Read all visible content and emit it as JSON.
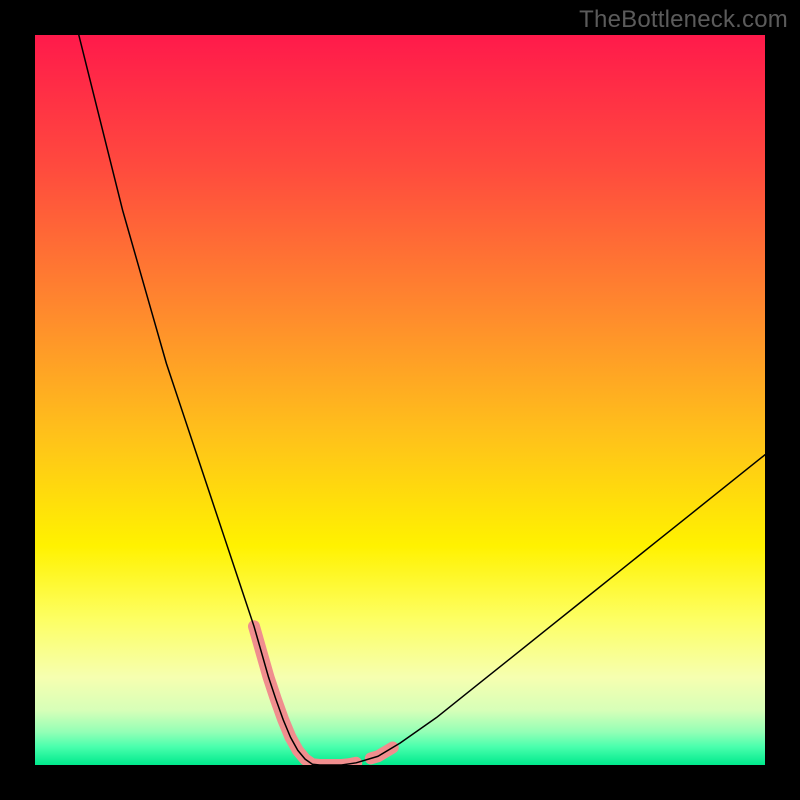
{
  "watermark": "TheBottleneck.com",
  "chart_data": {
    "type": "line",
    "title": "",
    "xlabel": "",
    "ylabel": "",
    "xlim": [
      0,
      100
    ],
    "ylim": [
      0,
      100
    ],
    "grid": false,
    "legend": false,
    "background": {
      "type": "vertical-gradient",
      "stops": [
        {
          "pos": 0.0,
          "color": "#ff1a4b"
        },
        {
          "pos": 0.18,
          "color": "#ff4a3e"
        },
        {
          "pos": 0.38,
          "color": "#ff8a2d"
        },
        {
          "pos": 0.55,
          "color": "#ffc21a"
        },
        {
          "pos": 0.7,
          "color": "#fff200"
        },
        {
          "pos": 0.8,
          "color": "#fdff63"
        },
        {
          "pos": 0.88,
          "color": "#f6ffb0"
        },
        {
          "pos": 0.925,
          "color": "#d7ffb8"
        },
        {
          "pos": 0.955,
          "color": "#93ffb6"
        },
        {
          "pos": 0.975,
          "color": "#4affad"
        },
        {
          "pos": 1.0,
          "color": "#00e98c"
        }
      ]
    },
    "series": [
      {
        "name": "bottleneck-curve",
        "stroke": "#000000",
        "stroke_width": 1.5,
        "x": [
          6,
          8,
          10,
          12,
          14,
          16,
          18,
          20,
          22,
          24,
          26,
          28,
          30,
          31,
          32,
          33,
          34,
          35,
          36,
          37,
          38,
          39,
          40,
          42,
          44,
          47,
          50,
          55,
          60,
          65,
          70,
          75,
          80,
          85,
          90,
          95,
          100
        ],
        "y": [
          100,
          92,
          84,
          76,
          69,
          62,
          55,
          49,
          43,
          37,
          31,
          25,
          19,
          15.5,
          12,
          9,
          6.2,
          3.8,
          2.0,
          0.8,
          0.1,
          0,
          0,
          0,
          0.3,
          1.2,
          3.0,
          6.5,
          10.5,
          14.5,
          18.5,
          22.5,
          26.5,
          30.5,
          34.5,
          38.5,
          42.5
        ]
      }
    ],
    "highlight_segments": [
      {
        "name": "left-near-minimum",
        "color": "#f08e8e",
        "stroke_width": 12,
        "x": [
          30,
          31,
          32,
          33,
          34,
          35
        ],
        "y": [
          19,
          15.5,
          12,
          9,
          6.2,
          3.8
        ]
      },
      {
        "name": "minimum-flat",
        "color": "#f08e8e",
        "stroke_width": 12,
        "x": [
          35,
          36,
          37,
          38,
          39,
          40,
          41,
          42,
          43,
          44
        ],
        "y": [
          3.8,
          2.0,
          0.8,
          0.1,
          0,
          0,
          0,
          0,
          0.1,
          0.3
        ]
      },
      {
        "name": "right-near-minimum",
        "color": "#f08e8e",
        "stroke_width": 12,
        "x": [
          46,
          47,
          48,
          49
        ],
        "y": [
          0.9,
          1.2,
          1.8,
          2.4
        ]
      }
    ]
  }
}
